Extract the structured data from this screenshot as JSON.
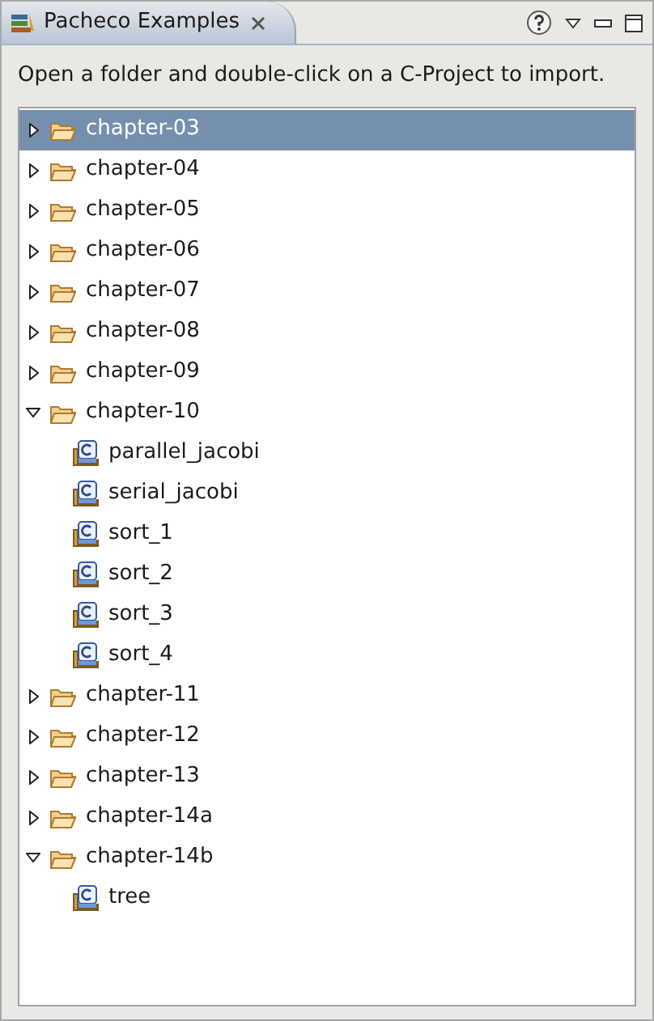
{
  "view": {
    "title": "Pacheco Examples"
  },
  "instruction": "Open a folder and double-click on a C-Project to import.",
  "tree": [
    {
      "label": "chapter-03",
      "kind": "folder",
      "expanded": false,
      "selected": true
    },
    {
      "label": "chapter-04",
      "kind": "folder",
      "expanded": false,
      "selected": false
    },
    {
      "label": "chapter-05",
      "kind": "folder",
      "expanded": false,
      "selected": false
    },
    {
      "label": "chapter-06",
      "kind": "folder",
      "expanded": false,
      "selected": false
    },
    {
      "label": "chapter-07",
      "kind": "folder",
      "expanded": false,
      "selected": false
    },
    {
      "label": "chapter-08",
      "kind": "folder",
      "expanded": false,
      "selected": false
    },
    {
      "label": "chapter-09",
      "kind": "folder",
      "expanded": false,
      "selected": false
    },
    {
      "label": "chapter-10",
      "kind": "folder",
      "expanded": true,
      "selected": false,
      "children": [
        {
          "label": "parallel_jacobi",
          "kind": "project",
          "selected": false
        },
        {
          "label": "serial_jacobi",
          "kind": "project",
          "selected": false
        },
        {
          "label": "sort_1",
          "kind": "project",
          "selected": false
        },
        {
          "label": "sort_2",
          "kind": "project",
          "selected": false
        },
        {
          "label": "sort_3",
          "kind": "project",
          "selected": false
        },
        {
          "label": "sort_4",
          "kind": "project",
          "selected": false
        }
      ]
    },
    {
      "label": "chapter-11",
      "kind": "folder",
      "expanded": false,
      "selected": false
    },
    {
      "label": "chapter-12",
      "kind": "folder",
      "expanded": false,
      "selected": false
    },
    {
      "label": "chapter-13",
      "kind": "folder",
      "expanded": false,
      "selected": false
    },
    {
      "label": "chapter-14a",
      "kind": "folder",
      "expanded": false,
      "selected": false
    },
    {
      "label": "chapter-14b",
      "kind": "folder",
      "expanded": true,
      "selected": false,
      "children": [
        {
          "label": "tree",
          "kind": "project",
          "selected": false
        }
      ]
    }
  ]
}
